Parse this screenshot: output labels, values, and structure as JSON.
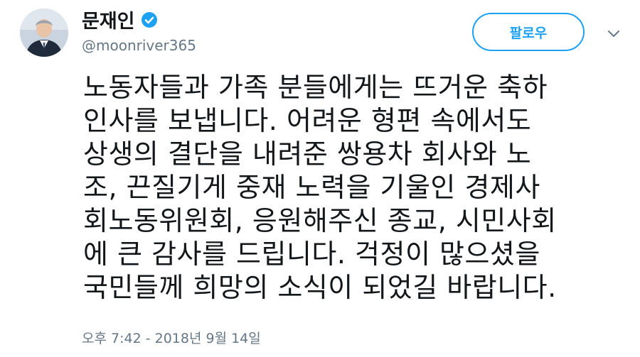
{
  "profile": {
    "display_name": "문재인",
    "handle": "@moonriver365",
    "verified": true,
    "avatar_icon": "profile-photo"
  },
  "follow_button": {
    "label": "팔로우",
    "color": "#1da1f2"
  },
  "menu_icon": "chevron-down-icon",
  "tweet": {
    "lines": [
      "노동자들과 가족 분들에게는 뜨거운 축하",
      "인사를 보냅니다. 어려운 형편 속에서도",
      "상생의 결단을 내려준 쌍용차 회사와 노",
      "조, 끈질기게 중재 노력을 기울인 경제사",
      "회노동위원회, 응원해주신 종교, 시민사회",
      "에 큰 감사를 드립니다. 걱정이 많으셨을",
      "국민들께 희망의 소식이 되었길 바랍니다."
    ],
    "timestamp": "오후 7:42 - 2018년 9월 14일"
  },
  "colors": {
    "text": "#14171a",
    "secondary": "#657786",
    "accent": "#1da1f2"
  }
}
